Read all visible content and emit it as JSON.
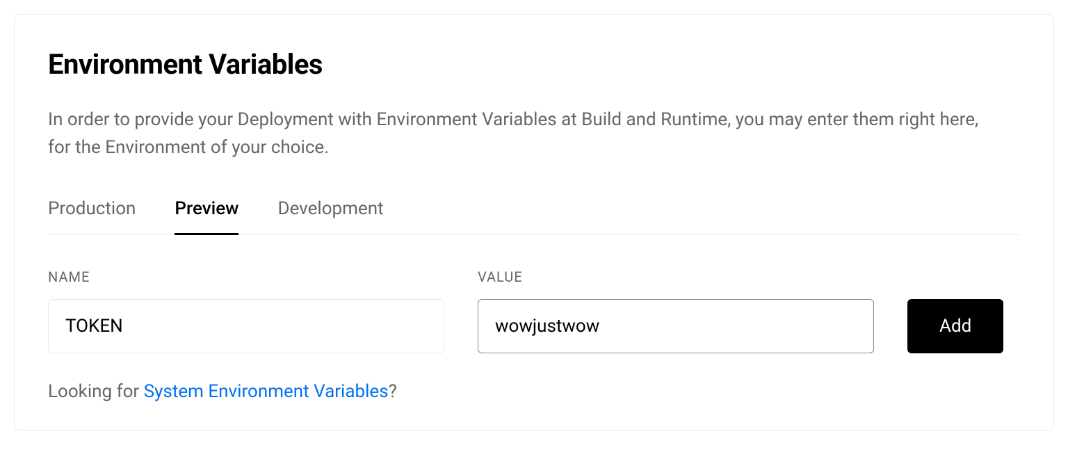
{
  "title": "Environment Variables",
  "description": "In order to provide your Deployment with Environment Variables at Build and Runtime, you may enter them right here, for the Environment of your choice.",
  "tabs": {
    "production": "Production",
    "preview": "Preview",
    "development": "Development",
    "active": "preview"
  },
  "form": {
    "name_label": "NAME",
    "value_label": "VALUE",
    "name_value": "TOKEN",
    "value_value": "wowjustwow",
    "add_button": "Add"
  },
  "footer": {
    "prefix": "Looking for ",
    "link": "System Environment Variables",
    "suffix": "?"
  }
}
